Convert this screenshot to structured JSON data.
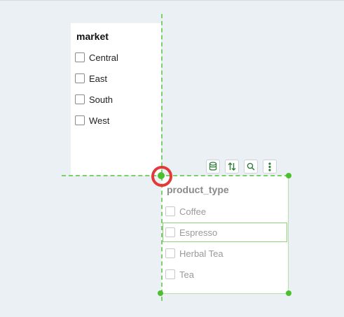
{
  "market_filter": {
    "title": "market",
    "items": [
      {
        "label": "Central",
        "checked": false
      },
      {
        "label": "East",
        "checked": false
      },
      {
        "label": "South",
        "checked": false
      },
      {
        "label": "West",
        "checked": false
      }
    ]
  },
  "product_type_filter": {
    "title": "product_type",
    "items": [
      {
        "label": "Coffee",
        "checked": false
      },
      {
        "label": "Espresso",
        "checked": false
      },
      {
        "label": "Herbal Tea",
        "checked": false
      },
      {
        "label": "Tea",
        "checked": false
      }
    ],
    "hovered_item": "Espresso"
  },
  "toolbar": {
    "icons": [
      "database-icon",
      "sort-icon",
      "search-icon",
      "more-vertical-icon"
    ]
  },
  "colors": {
    "guide": "#7bd06a",
    "handle": "#4cbf2f",
    "anchor_ring": "#e23a3a",
    "toolbar_icon": "#2e7d3a"
  }
}
